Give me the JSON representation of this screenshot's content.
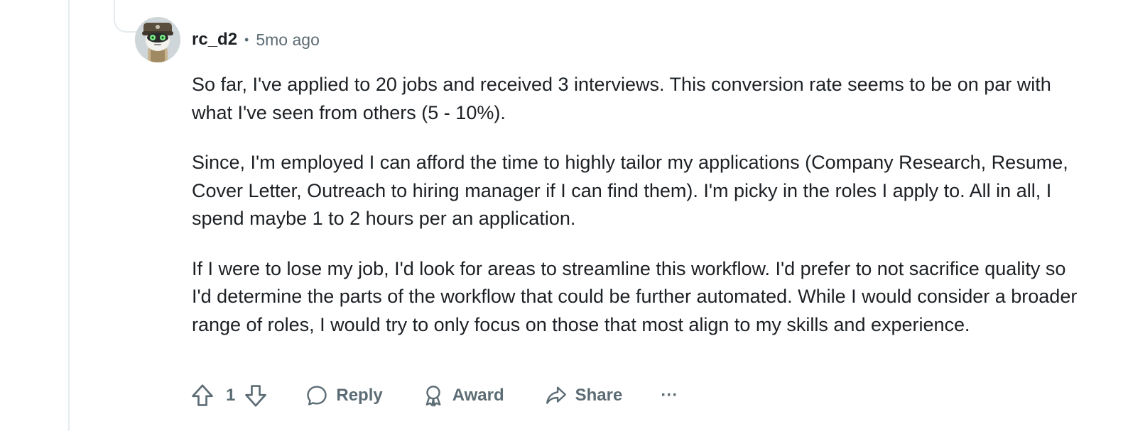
{
  "comment": {
    "username": "rc_d2",
    "separator": "•",
    "timestamp": "5mo ago",
    "paragraphs": [
      "So far, I've applied to 20 jobs and received 3 interviews. This conversion rate seems to be on par with what I've seen from others (5 - 10%).",
      "Since, I'm employed I can afford the time to highly tailor my applications (Company Research, Resume, Cover Letter, Outreach to hiring manager if I can find them). I'm picky in the roles I apply to. All in all, I spend maybe 1 to 2 hours per an application.",
      "If I were to lose my job, I'd look for areas to streamline this workflow. I'd prefer to not sacrifice quality so I'd determine the parts of the workflow that could be further automated. While I would consider a broader range of roles, I would try to only focus on those that most align to my skills and experience."
    ],
    "actions": {
      "vote_count": "1",
      "reply_label": "Reply",
      "award_label": "Award",
      "share_label": "Share",
      "more_label": "···"
    }
  },
  "icons": {
    "upvote": "upvote-arrow-icon",
    "downvote": "downvote-arrow-icon",
    "reply": "speech-bubble-icon",
    "award": "award-ribbon-icon",
    "share": "share-arrow-icon",
    "more": "ellipsis-icon"
  },
  "colors": {
    "text": "#1c2024",
    "meta": "#5c6c74",
    "thread_line": "#e5ebee"
  }
}
